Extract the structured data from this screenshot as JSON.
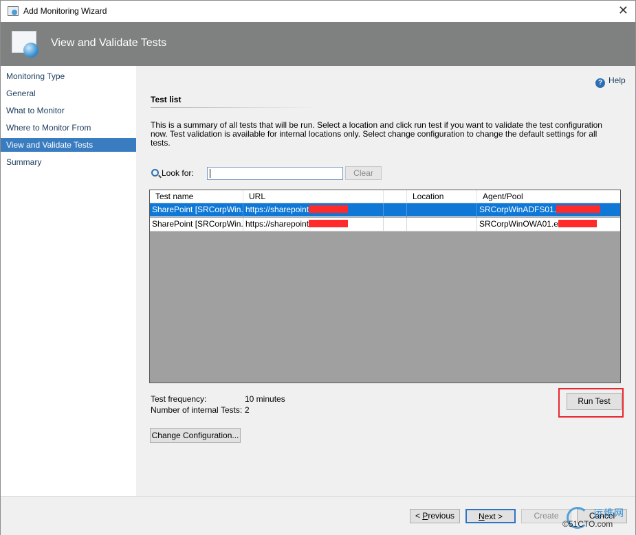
{
  "window": {
    "title": "Add Monitoring Wizard",
    "close_glyph": "✕"
  },
  "header": {
    "title": "View and Validate Tests"
  },
  "nav": {
    "items": [
      {
        "label": "Monitoring Type"
      },
      {
        "label": "General"
      },
      {
        "label": "What to Monitor"
      },
      {
        "label": "Where to Monitor From"
      },
      {
        "label": "View and Validate Tests",
        "selected": true
      },
      {
        "label": "Summary"
      }
    ]
  },
  "content": {
    "help_label": "Help",
    "section_title": "Test list",
    "description": "This is a summary of all tests that will be run. Select a location and click run test if you want to validate the test configuration now. Test validation is available for internal locations only. Select change configuration to change the default settings for all tests.",
    "lookfor_label": "Look for:",
    "search_value": "",
    "clear_label": "Clear",
    "columns": [
      "Test name",
      "URL",
      "",
      "Location",
      "Agent/Pool"
    ],
    "rows": [
      {
        "test_name": "SharePoint [SRCorpWin...",
        "url": "https://sharepoint",
        "blank": "",
        "location": "",
        "agent": "SRCorpWinADFS01.",
        "selected": true
      },
      {
        "test_name": "SharePoint [SRCorpWin...",
        "url": "https://sharepoint",
        "blank": "",
        "location": "",
        "agent": "SRCorpWinOWA01.e",
        "selected": false
      }
    ],
    "test_frequency_label": "Test frequency:",
    "test_frequency_value": "10 minutes",
    "internal_tests_label": "Number of internal Tests:",
    "internal_tests_value": "2",
    "run_test_label": "Run Test",
    "change_config_label": "Change Configuration..."
  },
  "footer": {
    "previous_prefix": "< ",
    "previous_accel": "P",
    "previous_rest": "revious",
    "next_accel": "N",
    "next_rest": "ext >",
    "create_label": "Create",
    "cancel_label": "Cancel"
  },
  "watermark": {
    "text": "运维网",
    "sub": "©51CTO.com"
  },
  "colors": {
    "header_bg": "#7f8180",
    "nav_selected": "#3a7cc0",
    "row_selected": "#0f78d7",
    "highlight_frame": "#e8262e",
    "redaction": "#ff2a2a"
  }
}
